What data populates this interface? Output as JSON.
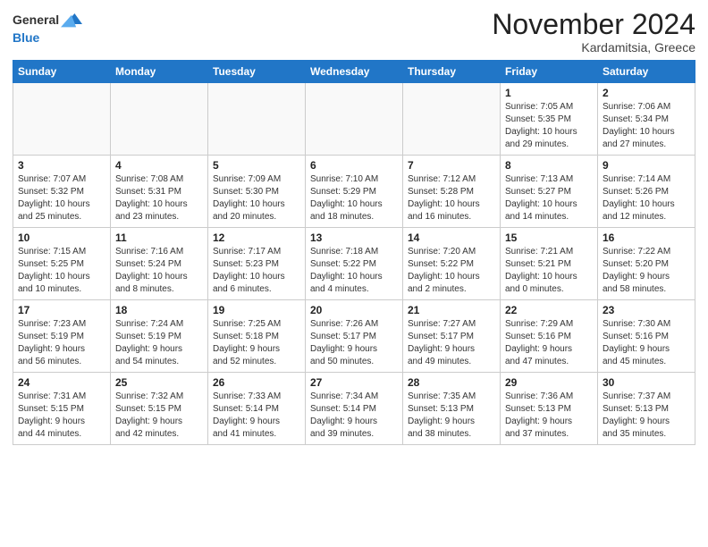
{
  "header": {
    "logo_general": "General",
    "logo_blue": "Blue",
    "month_title": "November 2024",
    "location": "Kardamitsia, Greece"
  },
  "weekdays": [
    "Sunday",
    "Monday",
    "Tuesday",
    "Wednesday",
    "Thursday",
    "Friday",
    "Saturday"
  ],
  "weeks": [
    [
      {
        "day": "",
        "info": ""
      },
      {
        "day": "",
        "info": ""
      },
      {
        "day": "",
        "info": ""
      },
      {
        "day": "",
        "info": ""
      },
      {
        "day": "",
        "info": ""
      },
      {
        "day": "1",
        "info": "Sunrise: 7:05 AM\nSunset: 5:35 PM\nDaylight: 10 hours\nand 29 minutes."
      },
      {
        "day": "2",
        "info": "Sunrise: 7:06 AM\nSunset: 5:34 PM\nDaylight: 10 hours\nand 27 minutes."
      }
    ],
    [
      {
        "day": "3",
        "info": "Sunrise: 7:07 AM\nSunset: 5:32 PM\nDaylight: 10 hours\nand 25 minutes."
      },
      {
        "day": "4",
        "info": "Sunrise: 7:08 AM\nSunset: 5:31 PM\nDaylight: 10 hours\nand 23 minutes."
      },
      {
        "day": "5",
        "info": "Sunrise: 7:09 AM\nSunset: 5:30 PM\nDaylight: 10 hours\nand 20 minutes."
      },
      {
        "day": "6",
        "info": "Sunrise: 7:10 AM\nSunset: 5:29 PM\nDaylight: 10 hours\nand 18 minutes."
      },
      {
        "day": "7",
        "info": "Sunrise: 7:12 AM\nSunset: 5:28 PM\nDaylight: 10 hours\nand 16 minutes."
      },
      {
        "day": "8",
        "info": "Sunrise: 7:13 AM\nSunset: 5:27 PM\nDaylight: 10 hours\nand 14 minutes."
      },
      {
        "day": "9",
        "info": "Sunrise: 7:14 AM\nSunset: 5:26 PM\nDaylight: 10 hours\nand 12 minutes."
      }
    ],
    [
      {
        "day": "10",
        "info": "Sunrise: 7:15 AM\nSunset: 5:25 PM\nDaylight: 10 hours\nand 10 minutes."
      },
      {
        "day": "11",
        "info": "Sunrise: 7:16 AM\nSunset: 5:24 PM\nDaylight: 10 hours\nand 8 minutes."
      },
      {
        "day": "12",
        "info": "Sunrise: 7:17 AM\nSunset: 5:23 PM\nDaylight: 10 hours\nand 6 minutes."
      },
      {
        "day": "13",
        "info": "Sunrise: 7:18 AM\nSunset: 5:22 PM\nDaylight: 10 hours\nand 4 minutes."
      },
      {
        "day": "14",
        "info": "Sunrise: 7:20 AM\nSunset: 5:22 PM\nDaylight: 10 hours\nand 2 minutes."
      },
      {
        "day": "15",
        "info": "Sunrise: 7:21 AM\nSunset: 5:21 PM\nDaylight: 10 hours\nand 0 minutes."
      },
      {
        "day": "16",
        "info": "Sunrise: 7:22 AM\nSunset: 5:20 PM\nDaylight: 9 hours\nand 58 minutes."
      }
    ],
    [
      {
        "day": "17",
        "info": "Sunrise: 7:23 AM\nSunset: 5:19 PM\nDaylight: 9 hours\nand 56 minutes."
      },
      {
        "day": "18",
        "info": "Sunrise: 7:24 AM\nSunset: 5:19 PM\nDaylight: 9 hours\nand 54 minutes."
      },
      {
        "day": "19",
        "info": "Sunrise: 7:25 AM\nSunset: 5:18 PM\nDaylight: 9 hours\nand 52 minutes."
      },
      {
        "day": "20",
        "info": "Sunrise: 7:26 AM\nSunset: 5:17 PM\nDaylight: 9 hours\nand 50 minutes."
      },
      {
        "day": "21",
        "info": "Sunrise: 7:27 AM\nSunset: 5:17 PM\nDaylight: 9 hours\nand 49 minutes."
      },
      {
        "day": "22",
        "info": "Sunrise: 7:29 AM\nSunset: 5:16 PM\nDaylight: 9 hours\nand 47 minutes."
      },
      {
        "day": "23",
        "info": "Sunrise: 7:30 AM\nSunset: 5:16 PM\nDaylight: 9 hours\nand 45 minutes."
      }
    ],
    [
      {
        "day": "24",
        "info": "Sunrise: 7:31 AM\nSunset: 5:15 PM\nDaylight: 9 hours\nand 44 minutes."
      },
      {
        "day": "25",
        "info": "Sunrise: 7:32 AM\nSunset: 5:15 PM\nDaylight: 9 hours\nand 42 minutes."
      },
      {
        "day": "26",
        "info": "Sunrise: 7:33 AM\nSunset: 5:14 PM\nDaylight: 9 hours\nand 41 minutes."
      },
      {
        "day": "27",
        "info": "Sunrise: 7:34 AM\nSunset: 5:14 PM\nDaylight: 9 hours\nand 39 minutes."
      },
      {
        "day": "28",
        "info": "Sunrise: 7:35 AM\nSunset: 5:13 PM\nDaylight: 9 hours\nand 38 minutes."
      },
      {
        "day": "29",
        "info": "Sunrise: 7:36 AM\nSunset: 5:13 PM\nDaylight: 9 hours\nand 37 minutes."
      },
      {
        "day": "30",
        "info": "Sunrise: 7:37 AM\nSunset: 5:13 PM\nDaylight: 9 hours\nand 35 minutes."
      }
    ]
  ]
}
